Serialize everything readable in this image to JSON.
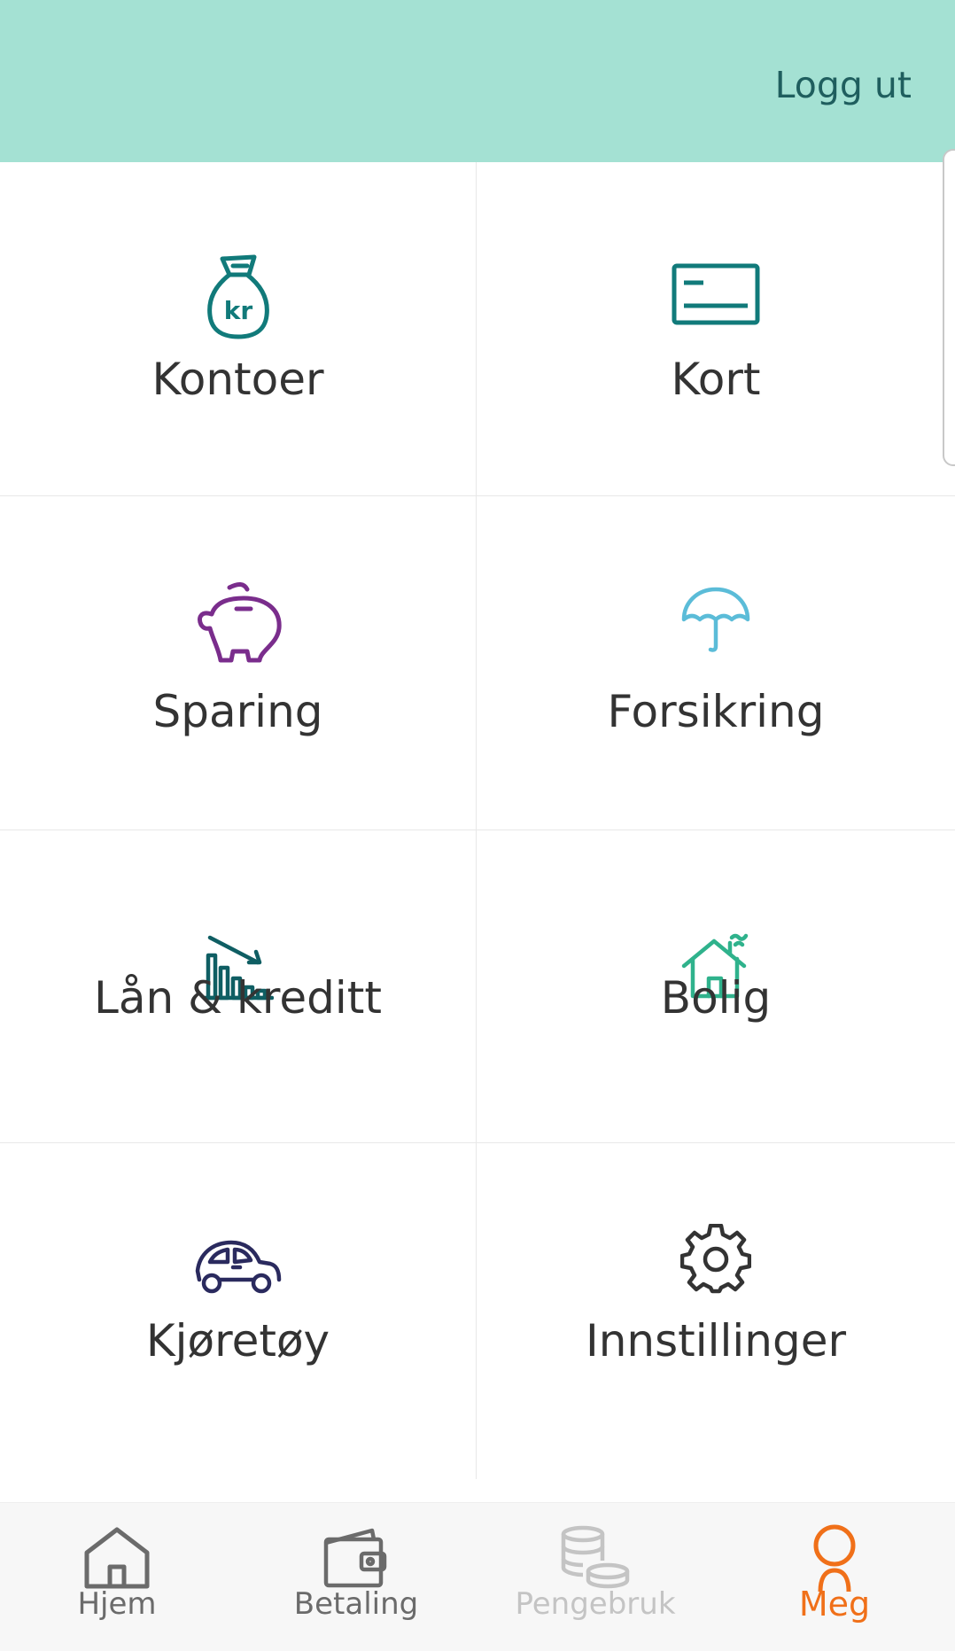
{
  "header": {
    "logout_label": "Logg ut"
  },
  "menu": {
    "tiles": [
      {
        "label": "Kontoer",
        "icon": "money-bag-icon",
        "color": "#117a7a"
      },
      {
        "label": "Kort",
        "icon": "card-icon",
        "color": "#117a7a"
      },
      {
        "label": "Sparing",
        "icon": "piggy-bank-icon",
        "color": "#7a2d8c"
      },
      {
        "label": "Forsikring",
        "icon": "umbrella-icon",
        "color": "#5bbcd8"
      },
      {
        "label": "Lån & kreditt",
        "icon": "loan-chart-icon",
        "color": "#0f5e63"
      },
      {
        "label": "Bolig",
        "icon": "house-icon",
        "color": "#2fb28c"
      },
      {
        "label": "Kjøretøy",
        "icon": "car-icon",
        "color": "#2a2a5e"
      },
      {
        "label": "Innstillinger",
        "icon": "gear-icon",
        "color": "#333333"
      }
    ]
  },
  "tabbar": {
    "tabs": [
      {
        "label": "Hjem",
        "icon": "home-icon",
        "state": "normal"
      },
      {
        "label": "Betaling",
        "icon": "wallet-icon",
        "state": "normal"
      },
      {
        "label": "Pengebruk",
        "icon": "coins-icon",
        "state": "disabled"
      },
      {
        "label": "Meg",
        "icon": "person-icon",
        "state": "active"
      }
    ],
    "colors": {
      "normal": "#6b6b6b",
      "disabled": "#c4c4c4",
      "active": "#f07019"
    }
  }
}
